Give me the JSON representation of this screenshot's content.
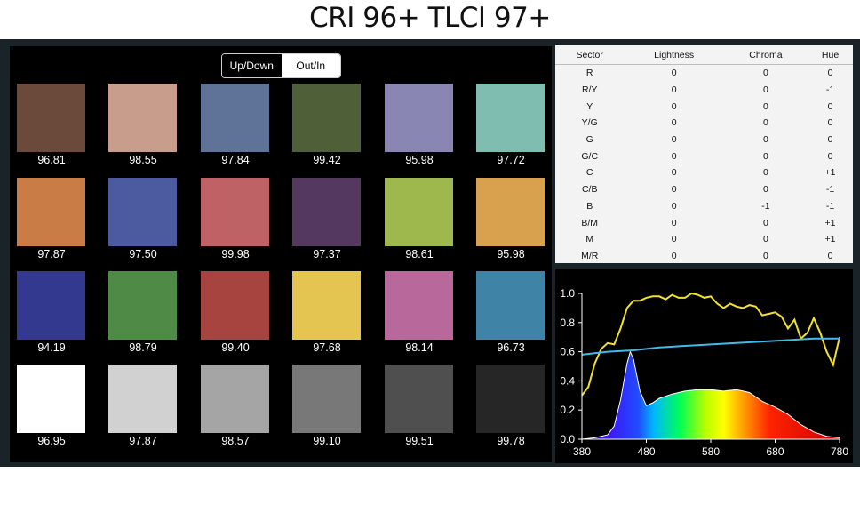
{
  "header": {
    "title": "CRI 96+   TLCI 97+"
  },
  "toggle": {
    "options": [
      "Up/Down",
      "Out/In"
    ],
    "selected": "Up/Down"
  },
  "patches": [
    {
      "color": "#6b4a3c",
      "value": "96.81"
    },
    {
      "color": "#c99d8c",
      "value": "98.55"
    },
    {
      "color": "#5f7399",
      "value": "97.84"
    },
    {
      "color": "#4f5f38",
      "value": "99.42"
    },
    {
      "color": "#8a86b3",
      "value": "95.98"
    },
    {
      "color": "#7fbdb0",
      "value": "97.72"
    },
    {
      "color": "#c97c46",
      "value": "97.87"
    },
    {
      "color": "#4c5a9f",
      "value": "97.50"
    },
    {
      "color": "#bf6266",
      "value": "99.98"
    },
    {
      "color": "#55385f",
      "value": "97.37"
    },
    {
      "color": "#9fb84e",
      "value": "98.61"
    },
    {
      "color": "#d7a14d",
      "value": "95.98"
    },
    {
      "color": "#33398f",
      "value": "94.19"
    },
    {
      "color": "#4f8a47",
      "value": "98.79"
    },
    {
      "color": "#a8443f",
      "value": "99.40"
    },
    {
      "color": "#e4c552",
      "value": "97.68"
    },
    {
      "color": "#b8689b",
      "value": "98.14"
    },
    {
      "color": "#3f84a6",
      "value": "96.73"
    },
    {
      "color": "#ffffff",
      "value": "96.95"
    },
    {
      "color": "#d1d1d1",
      "value": "97.87"
    },
    {
      "color": "#a5a5a5",
      "value": "98.57"
    },
    {
      "color": "#787878",
      "value": "99.10"
    },
    {
      "color": "#4f4f4f",
      "value": "99.51"
    },
    {
      "color": "#262626",
      "value": "99.78"
    }
  ],
  "table": {
    "headers": [
      "Sector",
      "Lightness",
      "Chroma",
      "Hue"
    ],
    "rows": [
      [
        "R",
        "0",
        "0",
        "0"
      ],
      [
        "R/Y",
        "0",
        "0",
        "-1"
      ],
      [
        "Y",
        "0",
        "0",
        "0"
      ],
      [
        "Y/G",
        "0",
        "0",
        "0"
      ],
      [
        "G",
        "0",
        "0",
        "0"
      ],
      [
        "G/C",
        "0",
        "0",
        "0"
      ],
      [
        "C",
        "0",
        "0",
        "+1"
      ],
      [
        "C/B",
        "0",
        "0",
        "-1"
      ],
      [
        "B",
        "0",
        "-1",
        "-1"
      ],
      [
        "B/M",
        "0",
        "0",
        "+1"
      ],
      [
        "M",
        "0",
        "0",
        "+1"
      ],
      [
        "M/R",
        "0",
        "0",
        "0"
      ]
    ]
  },
  "chart_data": {
    "type": "line",
    "title": "",
    "xlabel": "",
    "ylabel": "",
    "xlim": [
      380,
      780
    ],
    "ylim": [
      0,
      1.0
    ],
    "x_ticks": [
      "380",
      "480",
      "580",
      "680",
      "780"
    ],
    "y_ticks": [
      "1.0",
      "0.8",
      "0.6",
      "0.4",
      "0.2",
      "0.0"
    ],
    "grid": false,
    "series": [
      {
        "color": "#f2e32a",
        "x": [
          380,
          390,
          400,
          410,
          420,
          430,
          440,
          450,
          460,
          470,
          480,
          490,
          500,
          510,
          520,
          530,
          540,
          550,
          560,
          570,
          580,
          590,
          600,
          610,
          620,
          630,
          640,
          650,
          660,
          670,
          680,
          690,
          700,
          710,
          720,
          730,
          740,
          750,
          760,
          770,
          780
        ],
        "y": [
          0.3,
          0.36,
          0.52,
          0.62,
          0.66,
          0.65,
          0.76,
          0.9,
          0.95,
          0.95,
          0.97,
          0.98,
          0.98,
          0.96,
          0.99,
          0.97,
          0.97,
          1.0,
          0.99,
          0.97,
          0.98,
          0.93,
          0.9,
          0.93,
          0.91,
          0.9,
          0.92,
          0.91,
          0.85,
          0.86,
          0.87,
          0.84,
          0.76,
          0.82,
          0.69,
          0.73,
          0.83,
          0.73,
          0.6,
          0.51,
          0.7
        ]
      },
      {
        "color": "#45b9e6",
        "x": [
          380,
          420,
          460,
          500,
          540,
          580,
          620,
          660,
          700,
          740,
          780
        ],
        "y": [
          0.58,
          0.6,
          0.61,
          0.63,
          0.64,
          0.65,
          0.66,
          0.67,
          0.68,
          0.69,
          0.69
        ]
      },
      {
        "name": "spectrum",
        "fill": "gradient",
        "x": [
          380,
          400,
          420,
          430,
          440,
          450,
          455,
          460,
          470,
          480,
          490,
          500,
          520,
          540,
          560,
          580,
          600,
          620,
          630,
          640,
          650,
          660,
          680,
          700,
          720,
          740,
          760,
          780
        ],
        "y": [
          0.0,
          0.01,
          0.03,
          0.09,
          0.27,
          0.52,
          0.6,
          0.55,
          0.33,
          0.23,
          0.25,
          0.28,
          0.31,
          0.33,
          0.34,
          0.34,
          0.33,
          0.34,
          0.33,
          0.32,
          0.29,
          0.26,
          0.22,
          0.17,
          0.1,
          0.05,
          0.02,
          0.01
        ]
      }
    ]
  }
}
